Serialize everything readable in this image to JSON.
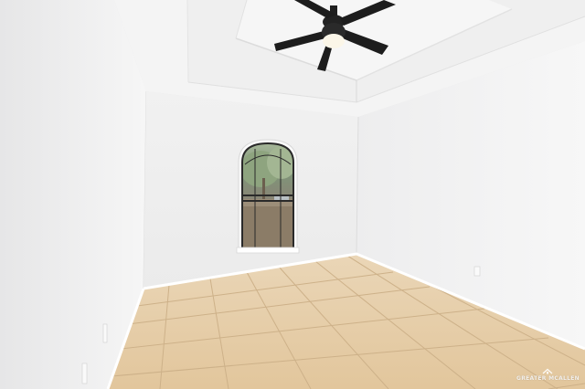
{
  "watermark": {
    "text": "GREATER MCALLEN",
    "icon": "house-roof-icon"
  },
  "colors": {
    "wall_left": "#f2f2f2",
    "wall_back": "#eeeeee",
    "wall_right": "#f1f1f2",
    "ceiling": "#f4f4f4",
    "floor_tile": "#e4c9a0",
    "grout": "#c9ad85",
    "baseboard": "#ffffff",
    "fan_body": "#1f1f1f",
    "fan_light": "#fbf6e8",
    "window_frame": "#2a2a2a",
    "window_trim": "#ffffff"
  }
}
